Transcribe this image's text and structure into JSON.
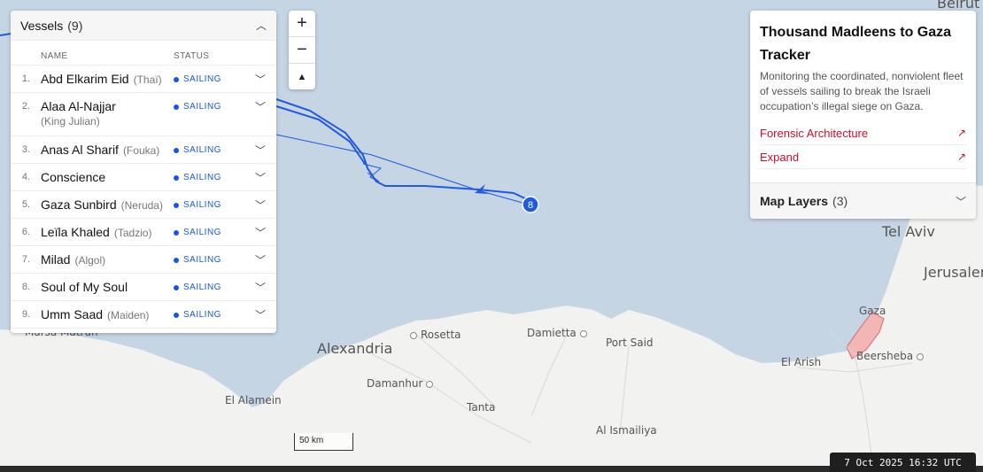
{
  "vessels_panel": {
    "title": "Vessels",
    "count": "(9)",
    "col_name": "NAME",
    "col_status": "STATUS",
    "items": [
      {
        "num": "1.",
        "name": "Abd Elkarim Eid",
        "alias": "(Thaï)",
        "status": "SAILING"
      },
      {
        "num": "2.",
        "name": "Alaa Al-Najjar",
        "alias": "(King Julian)",
        "status": "SAILING"
      },
      {
        "num": "3.",
        "name": "Anas Al Sharif",
        "alias": "(Fouka)",
        "status": "SAILING"
      },
      {
        "num": "4.",
        "name": "Conscience",
        "alias": "",
        "status": "SAILING"
      },
      {
        "num": "5.",
        "name": "Gaza Sunbird",
        "alias": "(Neruda)",
        "status": "SAILING"
      },
      {
        "num": "6.",
        "name": "Leïla Khaled",
        "alias": "(Tadzio)",
        "status": "SAILING"
      },
      {
        "num": "7.",
        "name": "Milad",
        "alias": "(Algol)",
        "status": "SAILING"
      },
      {
        "num": "8.",
        "name": "Soul of My Soul",
        "alias": "",
        "status": "SAILING"
      },
      {
        "num": "9.",
        "name": "Umm Saad",
        "alias": "(Maiden)",
        "status": "SAILING"
      }
    ]
  },
  "zoom": {
    "in": "+",
    "out": "−",
    "north": "▲"
  },
  "info_panel": {
    "title": "Thousand Madleens to Gaza Tracker",
    "description": "Monitoring the coordinated, nonviolent fleet of vessels sailing to break the Israeli occupation’s illegal siege on Gaza.",
    "link1": "Forensic Architecture",
    "link2": "Expand",
    "layers_label": "Map Layers",
    "layers_count": "(3)"
  },
  "map": {
    "cluster_label": "8",
    "places": {
      "alexandria": "Alexandria",
      "rosetta": "Rosetta",
      "damietta": "Damietta",
      "port_said": "Port Said",
      "el_arish": "El Arish",
      "gaza": "Gaza",
      "beersheba": "Beersheba",
      "tel_aviv": "Tel Aviv",
      "jerusalem": "Jerusalem",
      "beirut": "Beirut",
      "damanhur": "Damanhur",
      "el_alamein": "El Alamein",
      "tanta": "Tanta",
      "al_ismailiya": "Al Ismailiya",
      "marsa_matruh": "Marsa Matruh"
    },
    "colors": {
      "sea": "#c5d5e3",
      "land": "#f2f2f0",
      "track": "#1f5ae0",
      "gaza": "#f4b5b5"
    }
  },
  "scale": "50 km",
  "timestamp": "7 Oct 2025 16:32 UTC"
}
